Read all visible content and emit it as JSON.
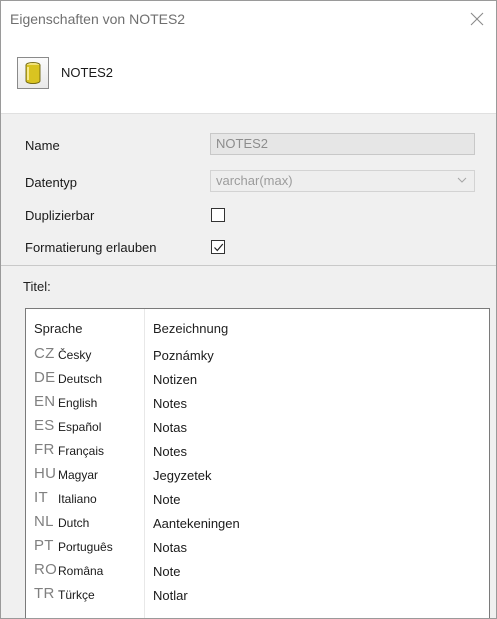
{
  "window": {
    "title": "Eigenschaften von NOTES2",
    "close_icon": "close-icon"
  },
  "header": {
    "object_name": "NOTES2",
    "object_icon": "database-column-icon"
  },
  "properties": {
    "name_label": "Name",
    "name_value": "NOTES2",
    "datatype_label": "Datentyp",
    "datatype_value": "varchar(max)",
    "duplicable_label": "Duplizierbar",
    "duplicable_checked": false,
    "formatting_label": "Formatierung erlauben",
    "formatting_checked": true
  },
  "titles": {
    "label": "Titel:",
    "columns": {
      "language": "Sprache",
      "designation": "Bezeichnung"
    },
    "rows": [
      {
        "code": "CZ",
        "language": "Česky",
        "value": "Poznámky"
      },
      {
        "code": "DE",
        "language": "Deutsch",
        "value": "Notizen"
      },
      {
        "code": "EN",
        "language": "English",
        "value": "Notes"
      },
      {
        "code": "ES",
        "language": "Español",
        "value": "Notas"
      },
      {
        "code": "FR",
        "language": "Français",
        "value": "Notes"
      },
      {
        "code": "HU",
        "language": "Magyar",
        "value": "Jegyzetek"
      },
      {
        "code": "IT",
        "language": "Italiano",
        "value": "Note"
      },
      {
        "code": "NL",
        "language": "Dutch",
        "value": "Aantekeningen"
      },
      {
        "code": "PT",
        "language": "Português",
        "value": "Notas"
      },
      {
        "code": "RO",
        "language": "Româna",
        "value": "Note"
      },
      {
        "code": "TR",
        "language": "Türkçe",
        "value": "Notlar"
      }
    ]
  },
  "colors": {
    "dialog_bg": "#f0f0f0",
    "disabled_text": "#8d8d8d",
    "code_text": "#808080",
    "icon_yellow": "#d9c321"
  }
}
